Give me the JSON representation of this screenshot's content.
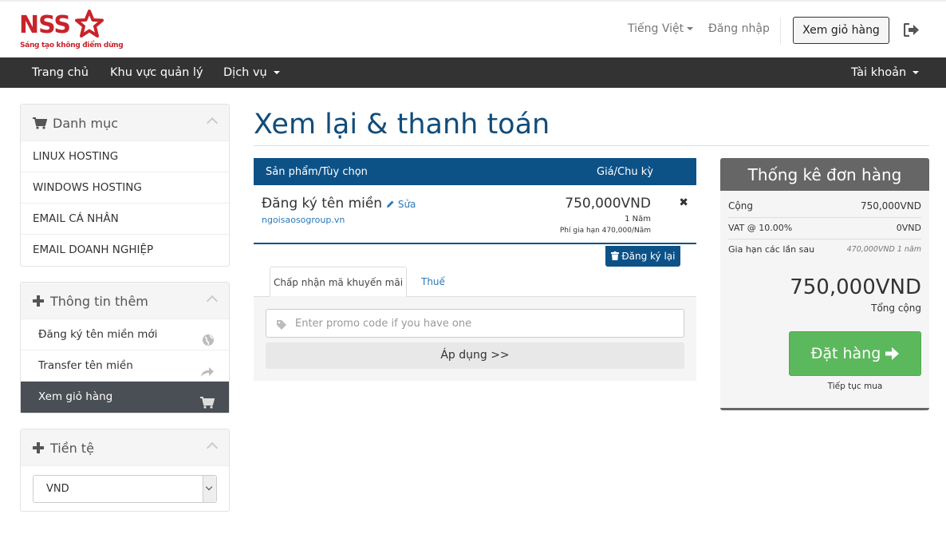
{
  "header": {
    "logo_text": "NSS",
    "slogan": "Sáng tạo không điểm dừng",
    "language": "Tiếng Việt",
    "login": "Đăng nhập",
    "view_cart": "Xem giỏ hàng",
    "brand_color": "#c8242b"
  },
  "nav": {
    "items": [
      "Trang chủ",
      "Khu vực quản lý",
      "Dịch vụ"
    ],
    "account": "Tài khoản"
  },
  "sidebar": {
    "categories": {
      "title": "Danh mục",
      "items": [
        "LINUX HOSTING",
        "WINDOWS HOSTING",
        "EMAIL CÁ NHÂN",
        "EMAIL DOANH NGHIỆP"
      ]
    },
    "more_info": {
      "title": "Thông tin thêm",
      "items": [
        {
          "label": "Đăng ký tên miền mới",
          "icon": "globe-icon"
        },
        {
          "label": "Transfer tên miền",
          "icon": "share-arrow-icon"
        },
        {
          "label": "Xem giỏ hàng",
          "icon": "cart-icon"
        }
      ]
    },
    "currency": {
      "title": "Tiền tệ",
      "selected": "VND"
    }
  },
  "main": {
    "title": "Xem lại & thanh toán",
    "table_headers": {
      "product": "Sản phẩm/Tùy chọn",
      "price": "Giá/Chu kỳ"
    },
    "item": {
      "name": "Đăng ký tên miền",
      "edit": "Sửa",
      "domain": "ngoisaosogroup.vn",
      "price": "750,000VND",
      "cycle": "1 Năm",
      "renewal": "Phí gia hạn 470,000/Năm"
    },
    "empty_cart": "Đăng ký lại",
    "tabs": {
      "promo": "Chấp nhận mã khuyến mãi",
      "tax": "Thuế"
    },
    "promo_placeholder": "Enter promo code if you have one",
    "apply": "Áp dụng >>"
  },
  "summary": {
    "title": "Thống kê đơn hàng",
    "subtotal_label": "Cộng",
    "subtotal": "750,000VND",
    "vat_label": "VAT @ 10.00%",
    "vat": "0VND",
    "renew_label": "Gia hạn các lần sau",
    "renew": "470,000VND 1 năm",
    "total": "750,000VND",
    "total_label": "Tổng cộng",
    "checkout": "Đặt hàng",
    "continue": "Tiếp tục mua"
  }
}
